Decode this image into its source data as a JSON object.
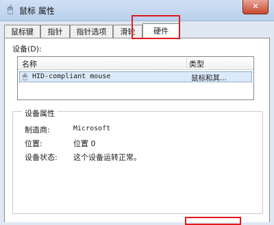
{
  "window": {
    "title": "鼠标 属性",
    "close_symbol": "✕"
  },
  "tabs": [
    {
      "label": "鼠标键"
    },
    {
      "label": "指针"
    },
    {
      "label": "指针选项"
    },
    {
      "label": "滑轮"
    },
    {
      "label": "硬件"
    }
  ],
  "active_tab": "硬件",
  "devices": {
    "label": "设备(D):",
    "columns": {
      "name": "名称",
      "type": "类型"
    },
    "rows": [
      {
        "name": "HID-compliant mouse",
        "type": "鼠标和其..."
      }
    ]
  },
  "properties": {
    "group_title": "设备属性",
    "manufacturer_label": "制造商:",
    "manufacturer_value": "Microsoft",
    "location_label": "位置:",
    "location_value": "位置 0",
    "status_label": "设备状态:",
    "status_value": "这个设备运转正常。"
  },
  "icons": {
    "app": "mouse-icon",
    "device": "mouse-icon"
  },
  "colors": {
    "highlight": "#e0191b",
    "selection": "#dce9f9"
  }
}
